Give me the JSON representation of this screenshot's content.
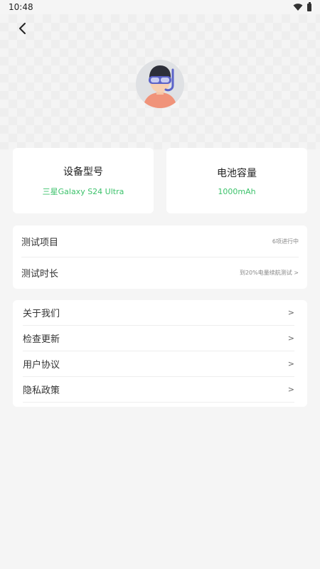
{
  "status_bar": {
    "time": "10:48"
  },
  "device_card": {
    "title": "设备型号",
    "value": "三星Galaxy S24 Ultra"
  },
  "battery_card": {
    "title": "电池容量",
    "value": "1000mAh"
  },
  "test_section": {
    "items": [
      {
        "label": "测试项目",
        "note": "6项进行中"
      },
      {
        "label": "测试时长",
        "note": "到20%电量续航测试 >"
      }
    ]
  },
  "menu": {
    "items": [
      {
        "label": "关于我们",
        "arrow": ">"
      },
      {
        "label": "检查更新",
        "arrow": ">"
      },
      {
        "label": "用户协议",
        "arrow": ">"
      },
      {
        "label": "隐私政策",
        "arrow": ">"
      }
    ]
  },
  "colors": {
    "accent": "#3cc26b",
    "background": "#f5f5f5",
    "card": "#ffffff"
  },
  "icons": [
    "back-arrow-icon",
    "wifi-icon",
    "battery-icon",
    "avatar-diver-icon"
  ]
}
